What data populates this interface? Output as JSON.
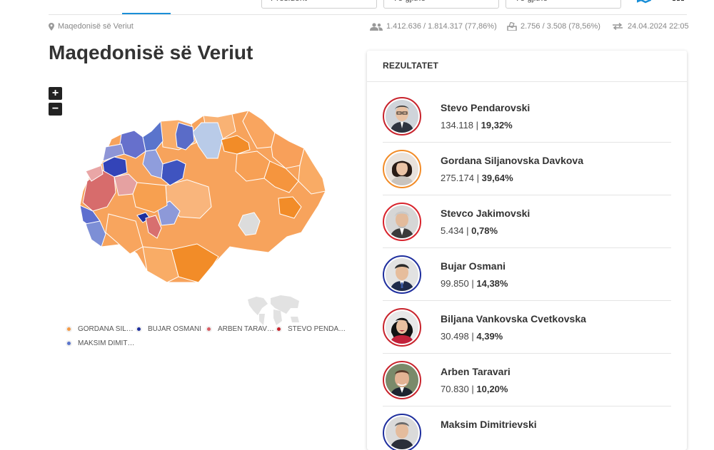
{
  "topbar": {
    "dropdowns": [
      "President",
      "Të gjithë",
      "Të gjithë"
    ]
  },
  "meta": {
    "location": "Maqedonisë së Veriut",
    "turnout": "1.412.636 / 1.814.317 (77,86%)",
    "polling_stations": "2.756 / 3.508 (78,56%)",
    "updated": "24.04.2024 22:05"
  },
  "title": "Maqedonisë së Veriut",
  "zoom": {
    "in": "+",
    "out": "−"
  },
  "legend": [
    {
      "label": "GORDANA SIL…",
      "color": "#f59a45"
    },
    {
      "label": "BUJAR OSMANI",
      "color": "#1f2f9e"
    },
    {
      "label": "ARBEN TARAV…",
      "color": "#d85c63"
    },
    {
      "label": "STEVO PENDA…",
      "color": "#c8232c"
    },
    {
      "label": "MAKSIM DIMIT…",
      "color": "#5a74cc"
    }
  ],
  "results": {
    "title": "REZULTATET",
    "candidates": [
      {
        "name": "Stevo Pendarovski",
        "votes": "134.118",
        "percent": "19,32%",
        "ring": "#c8232c"
      },
      {
        "name": "Gordana Siljanovska Davkova",
        "votes": "275.174",
        "percent": "39,64%",
        "ring": "#f28c28"
      },
      {
        "name": "Stevco Jakimovski",
        "votes": "5.434",
        "percent": "0,78%",
        "ring": "#d8232c"
      },
      {
        "name": "Bujar Osmani",
        "votes": "99.850",
        "percent": "14,38%",
        "ring": "#1f2f9e"
      },
      {
        "name": "Biljana Vankovska Cvetkovska",
        "votes": "30.498",
        "percent": "4,39%",
        "ring": "#c8232c"
      },
      {
        "name": "Arben Taravari",
        "votes": "70.830",
        "percent": "10,20%",
        "ring": "#c8232c"
      },
      {
        "name": "Maksim Dimitrievski",
        "votes": "",
        "percent": "",
        "ring": "#1f2f9e"
      }
    ]
  }
}
